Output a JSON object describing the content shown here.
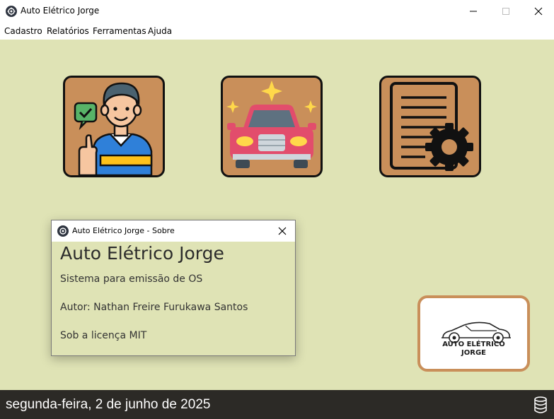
{
  "window": {
    "title": "Auto Elétrico Jorge",
    "icon": "gear-app-icon"
  },
  "menu": {
    "items": [
      "Cadastro",
      "Relatórios",
      "Ferramentas",
      "Ajuda"
    ]
  },
  "tiles": [
    {
      "name": "client-tile",
      "icon": "mechanic-thumbs-up-icon"
    },
    {
      "name": "vehicle-tile",
      "icon": "sparkling-car-icon"
    },
    {
      "name": "service-order-tile",
      "icon": "document-gear-icon"
    }
  ],
  "about_dialog": {
    "title": "Auto Elétrico Jorge - Sobre",
    "heading": "Auto Elétrico Jorge",
    "description": "Sistema para emissão de OS",
    "author": "Autor: Nathan Freire Furukawa Santos",
    "license": "Sob a licença MIT"
  },
  "logo": {
    "line1": "AUTO ELÉTRICO",
    "line2": "JORGE"
  },
  "status": {
    "date": "segunda-feira, 2 de junho de 2025",
    "db_icon": "database-icon"
  },
  "colors": {
    "background": "#dfe3b5",
    "tile": "#c98f5a",
    "statusbar": "#2c2a26"
  }
}
